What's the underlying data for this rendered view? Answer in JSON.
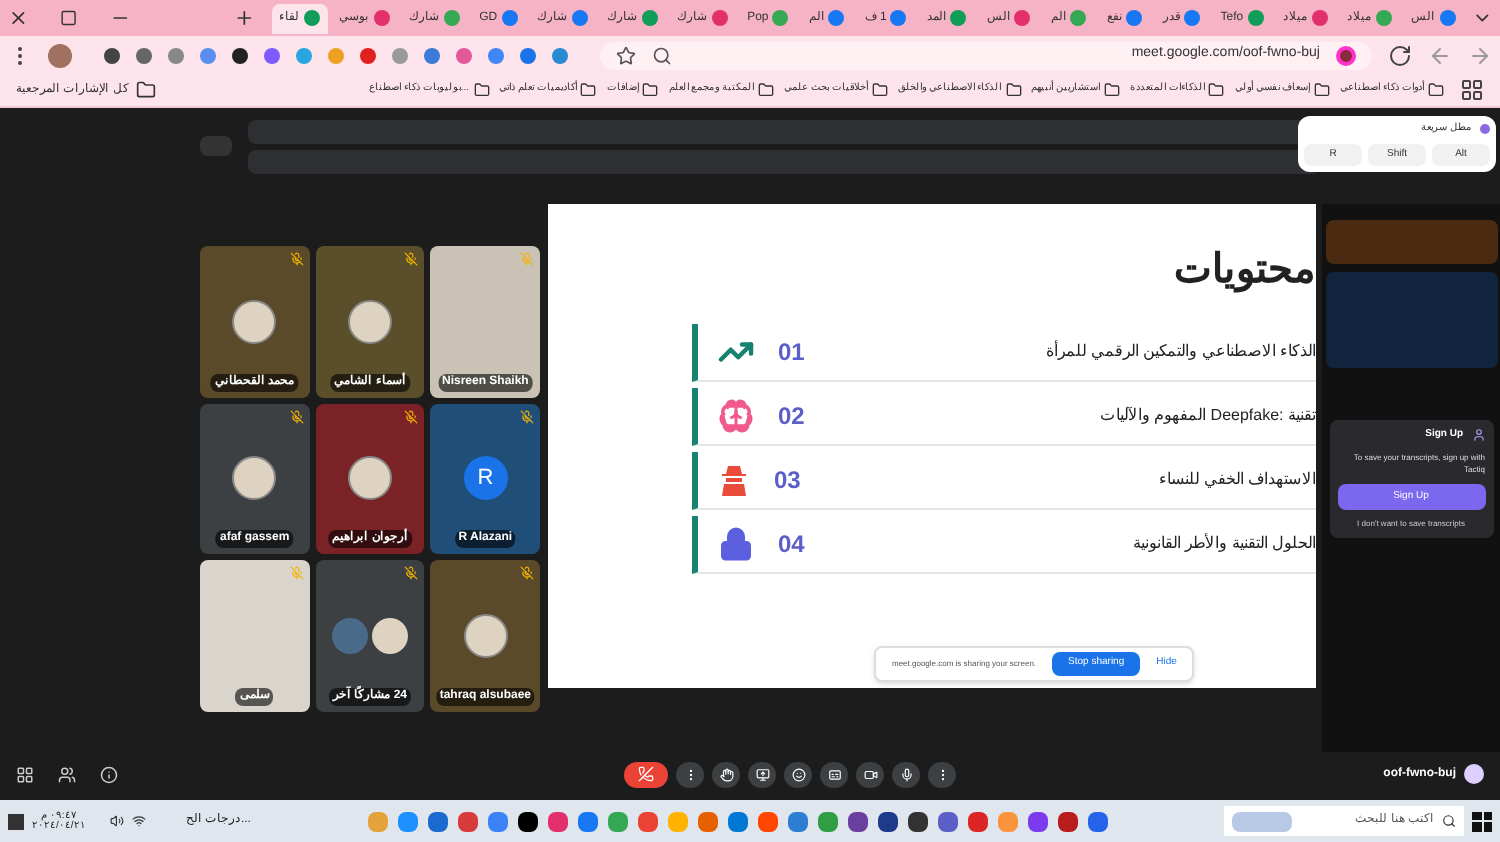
{
  "browser": {
    "tabs": [
      {
        "title": "الس",
        "selected": false
      },
      {
        "title": "ميلاد",
        "selected": false
      },
      {
        "title": "ميلاد",
        "selected": false
      },
      {
        "title": "Tefo",
        "selected": false
      },
      {
        "title": "قدر",
        "selected": false
      },
      {
        "title": "نفع",
        "selected": false
      },
      {
        "title": "الم",
        "selected": false
      },
      {
        "title": "الس",
        "selected": false
      },
      {
        "title": "المد",
        "selected": false
      },
      {
        "title": "1 ف",
        "selected": false
      },
      {
        "title": "الم",
        "selected": false
      },
      {
        "title": "Pop",
        "selected": false
      },
      {
        "title": "شارك",
        "selected": false
      },
      {
        "title": "شارك",
        "selected": false
      },
      {
        "title": "شارك",
        "selected": false
      },
      {
        "title": "GD",
        "selected": false
      },
      {
        "title": "شارك",
        "selected": false
      },
      {
        "title": "بوسي",
        "selected": false
      },
      {
        "title": "لقاء",
        "selected": true
      }
    ],
    "url": "meet.google.com/oof-fwno-buj",
    "bookmarks": [
      "أدوات ذكاء اصطناعي",
      "إسعاف نفسي أولي",
      "الذكاءات المتعددة",
      "استشاريين أنبيهم",
      "الذكاء الاصطناعي والخلق",
      "أخلاقيات بحث علمي",
      "المكتبة ومجمع العلم",
      "إضافات",
      "أكاديميات تعلم ذاتي",
      "بوليوبات ذكاء اصطناع..."
    ],
    "all_bookmarks": "كل الإشارات المرجعية"
  },
  "meet": {
    "tiles": [
      {
        "name": "Nisreen Shaikh",
        "kind": "photo",
        "color": "#c9c2b5"
      },
      {
        "name": "أسماء الشامي",
        "kind": "avatar",
        "color": "#5a4f2a"
      },
      {
        "name": "محمد القحطاني",
        "kind": "avatar",
        "color": "#5a4a2a"
      },
      {
        "name": "R Alazani",
        "kind": "initial",
        "initial": "R",
        "color": "#1f4e79"
      },
      {
        "name": "أرجوان ابراهيم",
        "kind": "avatar",
        "color": "#7a2226"
      },
      {
        "name": "afaf gassem",
        "kind": "avatar",
        "color": "#3c4043"
      },
      {
        "name": "tahraq alsubaee",
        "kind": "avatar",
        "color": "#5a4a2a"
      },
      {
        "name": "24 مشاركًا آخر",
        "kind": "group",
        "color": "#3c4043"
      },
      {
        "name": "سلمى",
        "kind": "photo",
        "color": "#d9d4cc"
      }
    ],
    "slide": {
      "title": "محتويات",
      "items": [
        {
          "number": "01",
          "text": "الذكاء الاصطناعي والتمكين الرقمي للمرأة",
          "kind": "chart"
        },
        {
          "number": "02",
          "text": "تقنية :Deepfake المفهوم والآليات",
          "kind": "brain"
        },
        {
          "number": "03",
          "text": "الاستهداف الخفي للنساء",
          "kind": "spy"
        },
        {
          "number": "04",
          "text": "الحلول التقنية والأطر القانونية",
          "kind": "lock"
        }
      ]
    },
    "share_bar": {
      "message": "meet.google.com is sharing your screen.",
      "stop": "Stop sharing",
      "hide": "Hide"
    },
    "shortcut_popup": {
      "title": "مطل سريعة",
      "keys": [
        "Alt",
        "Shift",
        "R"
      ]
    },
    "signup_card": {
      "title": "Sign Up",
      "message": "To save your transcripts, sign up with Tactiq",
      "button": "Sign Up",
      "decline": "I don't want to save transcripts"
    },
    "meeting_code": "oof-fwno-buj"
  },
  "taskbar": {
    "search_placeholder": "اكتب هنا للبحث",
    "weather": "درجات الح...",
    "time": "٠٩:٤٧ م",
    "date": "٢٠٢٤/٠٤/٢١"
  }
}
